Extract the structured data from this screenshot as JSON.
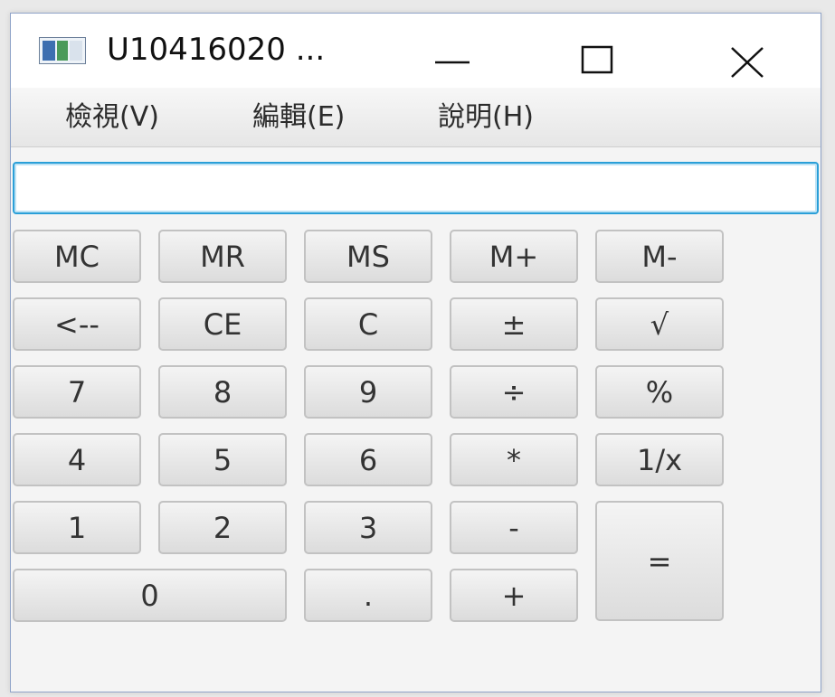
{
  "window": {
    "title": "U10416020 ...",
    "controls": {
      "minimize_icon": "minimize-icon",
      "maximize_icon": "maximize-icon",
      "close_icon": "close-icon"
    }
  },
  "menubar": {
    "view": "檢視(V)",
    "edit": "編輯(E)",
    "help": "說明(H)"
  },
  "display": {
    "value": ""
  },
  "buttons": {
    "mc": "MC",
    "mr": "MR",
    "ms": "MS",
    "mplus": "M+",
    "mminus": "M-",
    "backspace": "<--",
    "ce": "CE",
    "c": "C",
    "plusminus": "±",
    "sqrt": "√",
    "n7": "7",
    "n8": "8",
    "n9": "9",
    "divide": "÷",
    "percent": "%",
    "n4": "4",
    "n5": "5",
    "n6": "6",
    "multiply": "*",
    "reciprocal": "1/x",
    "n1": "1",
    "n2": "2",
    "n3": "3",
    "minus": "-",
    "equals": "=",
    "n0": "0",
    "dot": ".",
    "plus": "+"
  }
}
